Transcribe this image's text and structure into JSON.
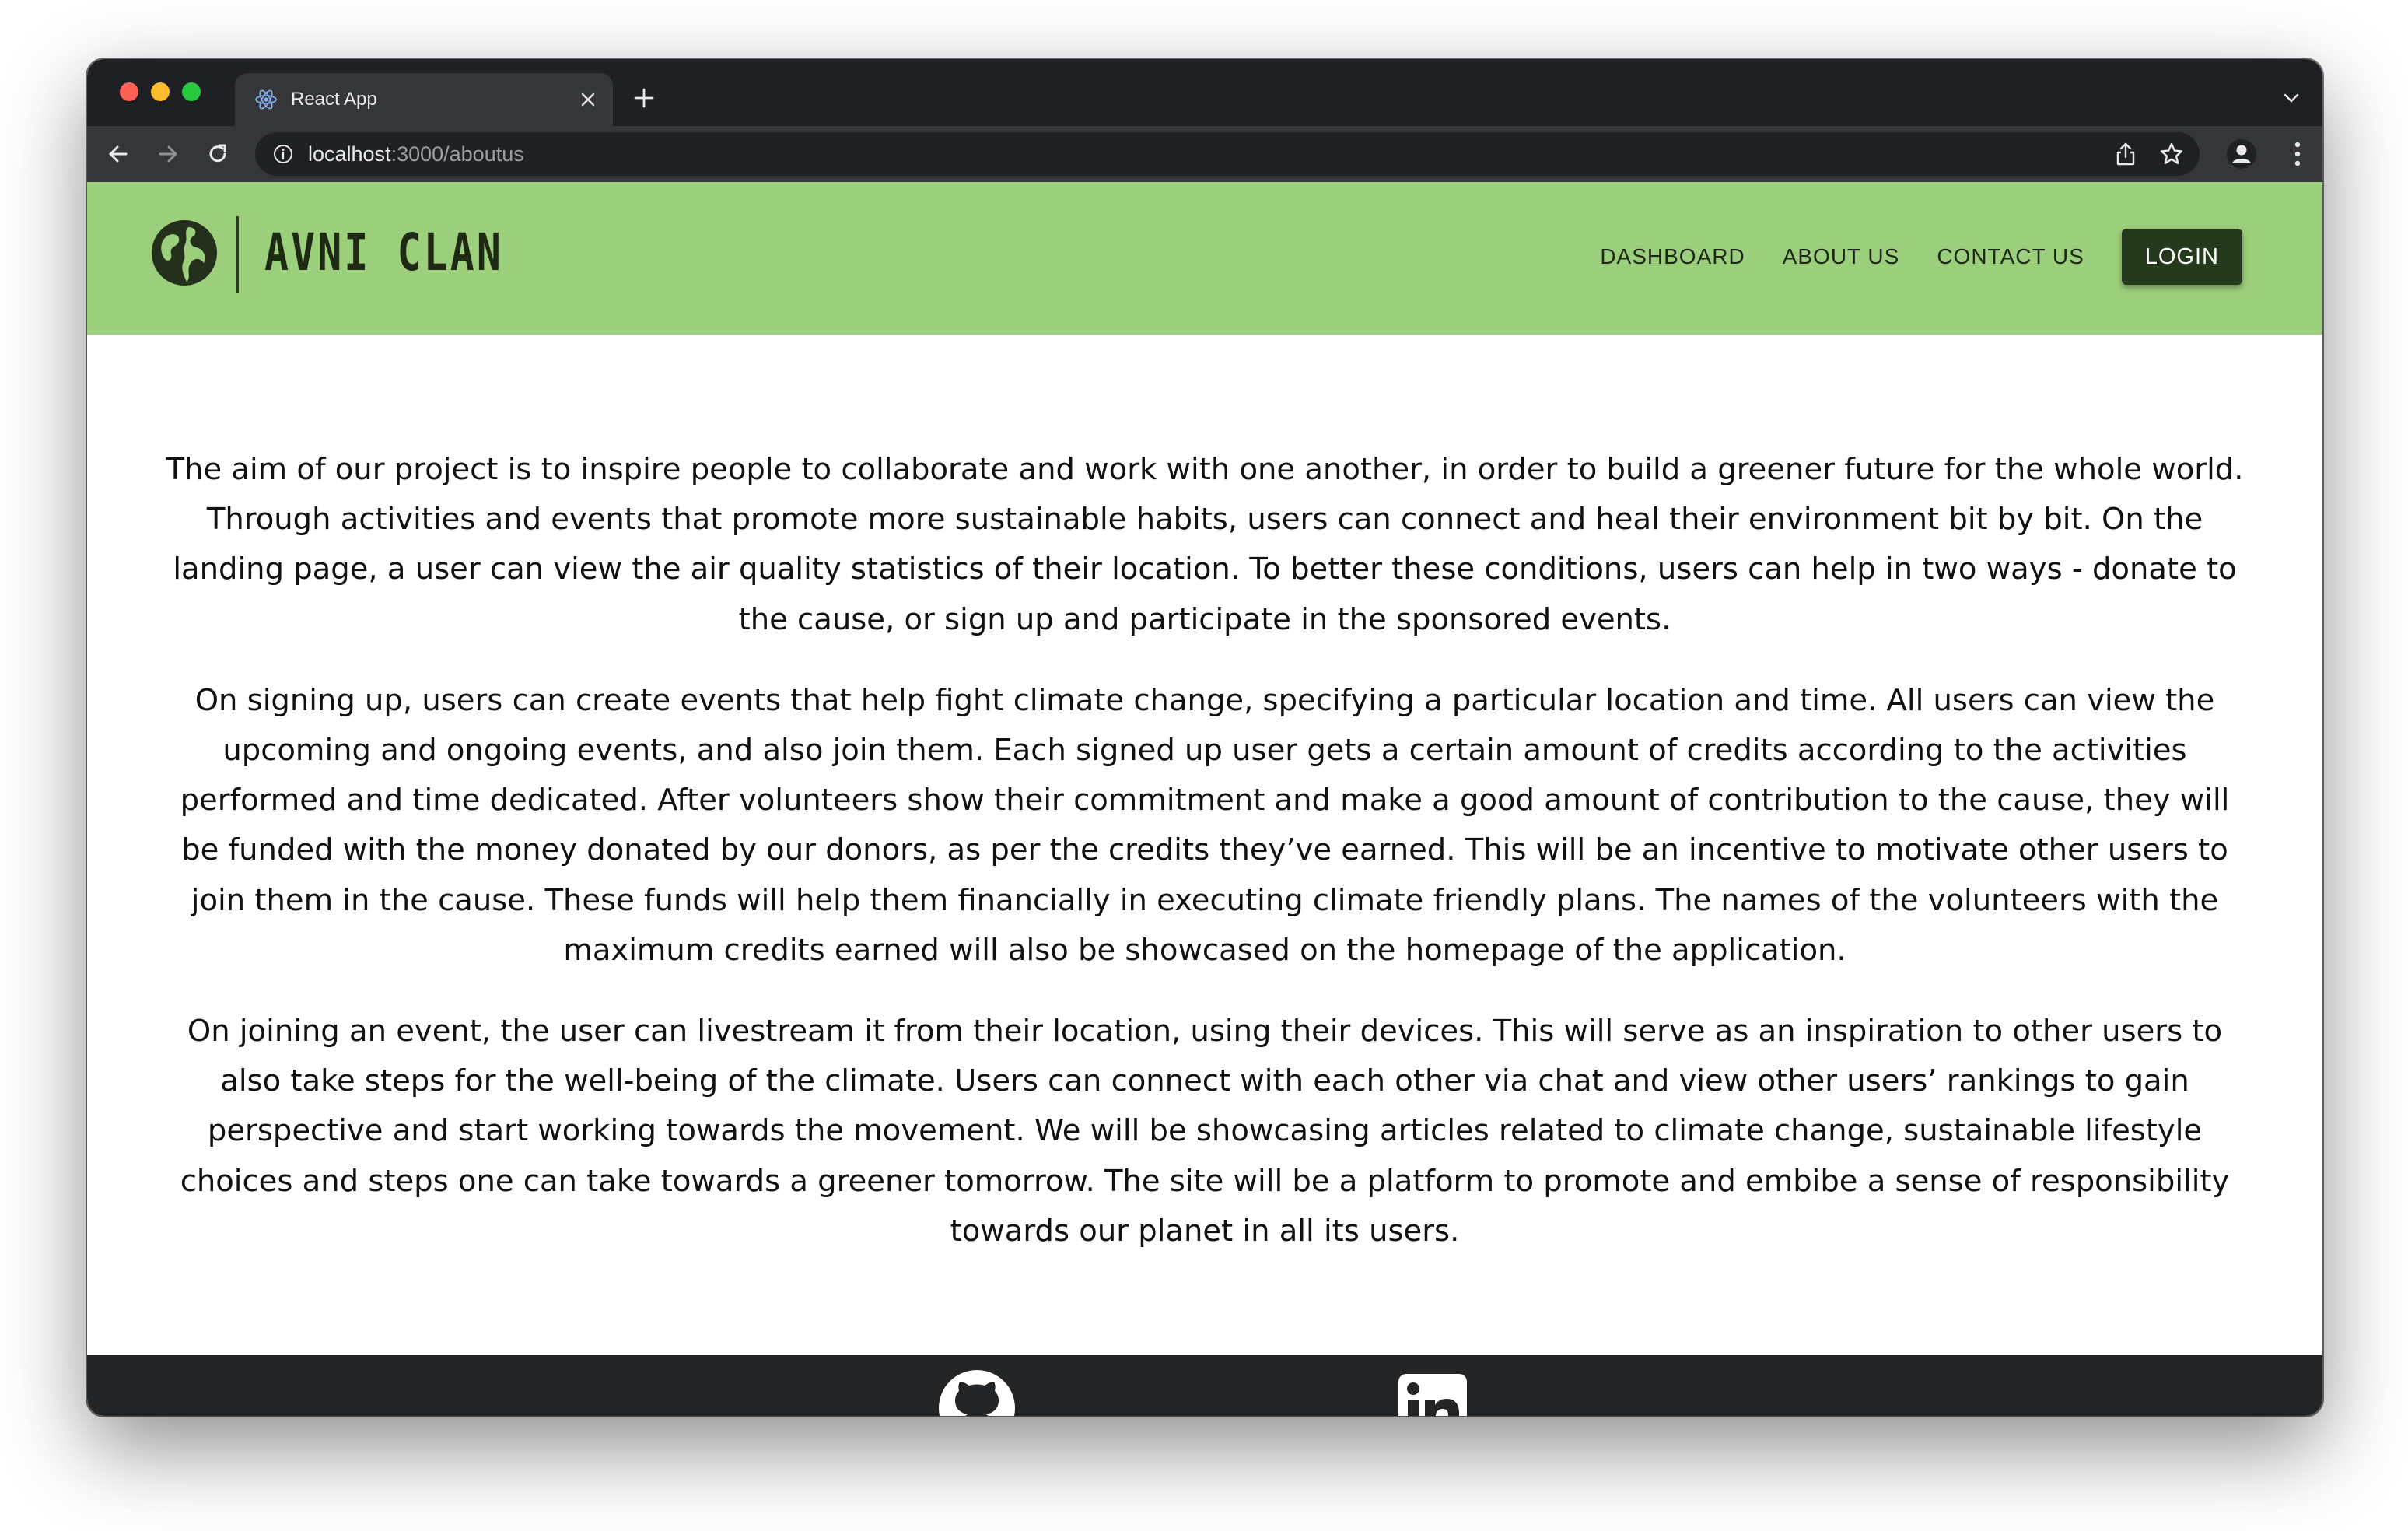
{
  "browser": {
    "tab_title": "React App",
    "url_host": "localhost",
    "url_rest": ":3000/aboutus"
  },
  "site": {
    "brand": "AVNI CLAN",
    "nav": [
      "DASHBOARD",
      "ABOUT US",
      "CONTACT US"
    ],
    "login_label": "LOGIN",
    "colors": {
      "header_bg": "#9ccf7b",
      "login_bg": "#253a1c",
      "footer_bg": "#242526"
    }
  },
  "about": {
    "paragraphs": [
      "The aim of our project is to inspire people to collaborate and work with one another, in order to build a greener future for the whole world. Through activities and events that promote more sustainable habits, users can connect and heal their environment bit by bit. On the landing page, a user can view the air quality statistics of their location. To better these conditions, users can help in two ways - donate to the cause, or sign up and participate in the sponsored events.",
      "On signing up, users can create events that help fight climate change, specifying a particular location and time. All users can view the upcoming and ongoing events, and also join them. Each signed up user gets a certain amount of credits according to the activities performed and time dedicated. After volunteers show their commitment and make a good amount of contribution to the cause, they will be funded with the money donated by our donors, as per the credits they’ve earned. This will be an incentive to motivate other users to join them in the cause. These funds will help them financially in executing climate friendly plans. The names of the volunteers with the maximum credits earned will also be showcased on the homepage of the application.",
      "On joining an event, the user can livestream it from their location, using their devices. This will serve as an inspiration to other users to also take steps for the well-being of the climate. Users can connect with each other via chat and view other users’ rankings to gain perspective and start working towards the movement. We will be showcasing articles related to climate change, sustainable lifestyle choices and steps one can take towards a greener tomorrow. The site will be a platform to promote and embibe a sense of responsibility towards our planet in all its users."
    ]
  },
  "footer": {
    "icons": [
      "github-icon",
      "linkedin-icon"
    ]
  }
}
